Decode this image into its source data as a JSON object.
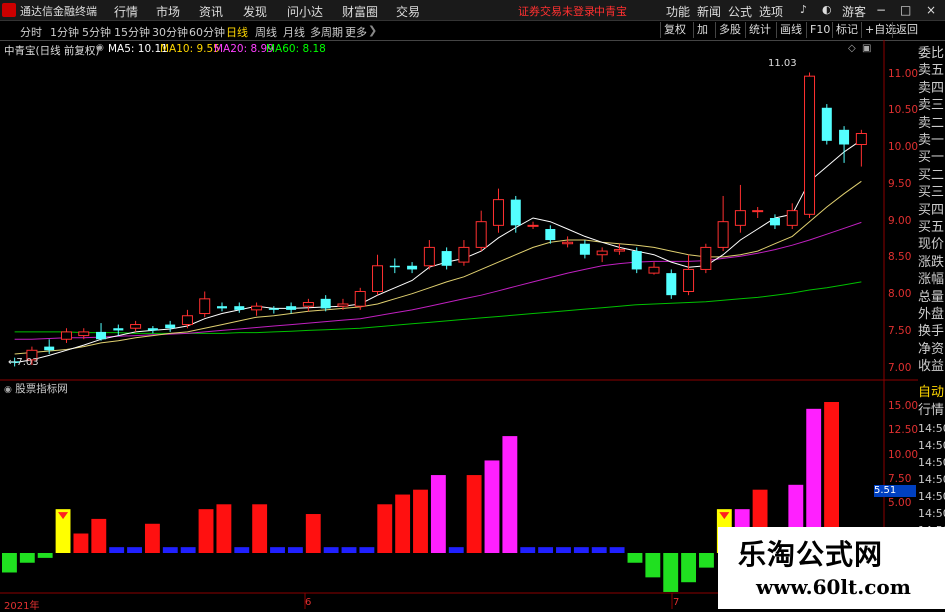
{
  "window": {
    "app_name": "通达信金融终端",
    "menus": [
      "行情",
      "市场",
      "资讯",
      "发现",
      "问小达",
      "财富圈",
      "交易"
    ],
    "warning": "证券交易未登录",
    "stock_name": "中青宝",
    "right_menus": [
      "功能",
      "新闻",
      "公式",
      "选项"
    ],
    "guest": "游客",
    "window_controls": [
      "−",
      "□",
      "×"
    ]
  },
  "toolbar": {
    "periods": [
      "分时",
      "1分钟",
      "5分钟",
      "15分钟",
      "30分钟",
      "60分钟",
      "日线",
      "周线",
      "月线",
      "多周期",
      "更多"
    ],
    "active_period": "日线",
    "buttons": [
      "复权",
      "加",
      "多股",
      "统计",
      "画线",
      "F10",
      "标记",
      "+自选",
      "返回"
    ]
  },
  "infobar": {
    "title": "中青宝(日线 前复权)",
    "ma5": "MA5: 10.11",
    "ma10": "MA10: 9.55",
    "ma20": "MA20: 8.99",
    "ma60": "MA60: 8.18",
    "colors": {
      "ma5": "#ffffff",
      "ma10": "#ffd700",
      "ma20": "#ff40ff",
      "ma60": "#00ff00"
    }
  },
  "side_panel": {
    "items": [
      "委比",
      "卖五",
      "卖四",
      "卖三",
      "卖二",
      "卖一",
      "买一",
      "买二",
      "买三",
      "买四",
      "买五",
      "现价",
      "涨跌",
      "涨幅",
      "总量",
      "外盘",
      "换手",
      "净资",
      "收益"
    ],
    "lower_items": [
      "自动",
      "行情"
    ]
  },
  "price_axis": {
    "ticks": [
      "11.00",
      "10.50",
      "10.00",
      "9.50",
      "9.00",
      "8.50",
      "8.00",
      "7.50",
      "7.00"
    ],
    "high_label": "11.03",
    "low_label": "7.03"
  },
  "indicator": {
    "title": "股票指标网",
    "ticks": [
      "15.00",
      "12.50",
      "10.00",
      "7.50",
      "5.00"
    ],
    "value_label": "5.51",
    "time_labels": [
      "14:50",
      "14:50",
      "14:50",
      "14:50",
      "14:50",
      "14:50",
      "14:50",
      "14:50",
      "14:50"
    ]
  },
  "date_axis": {
    "labels": [
      "2021年",
      "6",
      "7"
    ]
  },
  "chart_data": {
    "type": "candlestick",
    "price_range": [
      6.9,
      11.2
    ],
    "candles": [
      {
        "o": 7.1,
        "c": 7.08,
        "h": 7.15,
        "l": 7.03
      },
      {
        "o": 7.12,
        "c": 7.25,
        "h": 7.3,
        "l": 7.05
      },
      {
        "o": 7.3,
        "c": 7.25,
        "h": 7.4,
        "l": 7.2
      },
      {
        "o": 7.4,
        "c": 7.5,
        "h": 7.55,
        "l": 7.35
      },
      {
        "o": 7.45,
        "c": 7.5,
        "h": 7.55,
        "l": 7.4
      },
      {
        "o": 7.5,
        "c": 7.4,
        "h": 7.62,
        "l": 7.38
      },
      {
        "o": 7.55,
        "c": 7.52,
        "h": 7.6,
        "l": 7.45
      },
      {
        "o": 7.55,
        "c": 7.6,
        "h": 7.65,
        "l": 7.5
      },
      {
        "o": 7.55,
        "c": 7.52,
        "h": 7.58,
        "l": 7.48
      },
      {
        "o": 7.6,
        "c": 7.55,
        "h": 7.65,
        "l": 7.5
      },
      {
        "o": 7.6,
        "c": 7.72,
        "h": 7.8,
        "l": 7.55
      },
      {
        "o": 7.75,
        "c": 7.95,
        "h": 8.05,
        "l": 7.7
      },
      {
        "o": 7.85,
        "c": 7.82,
        "h": 7.9,
        "l": 7.78
      },
      {
        "o": 7.85,
        "c": 7.8,
        "h": 7.9,
        "l": 7.76
      },
      {
        "o": 7.8,
        "c": 7.85,
        "h": 7.9,
        "l": 7.72
      },
      {
        "o": 7.82,
        "c": 7.8,
        "h": 7.85,
        "l": 7.75
      },
      {
        "o": 7.85,
        "c": 7.8,
        "h": 7.9,
        "l": 7.75
      },
      {
        "o": 7.85,
        "c": 7.9,
        "h": 7.95,
        "l": 7.78
      },
      {
        "o": 7.95,
        "c": 7.82,
        "h": 8.0,
        "l": 7.78
      },
      {
        "o": 7.85,
        "c": 7.88,
        "h": 7.95,
        "l": 7.8
      },
      {
        "o": 7.85,
        "c": 8.05,
        "h": 8.1,
        "l": 7.8
      },
      {
        "o": 8.05,
        "c": 8.4,
        "h": 8.55,
        "l": 8.0
      },
      {
        "o": 8.4,
        "c": 8.38,
        "h": 8.5,
        "l": 8.3
      },
      {
        "o": 8.4,
        "c": 8.35,
        "h": 8.45,
        "l": 8.3
      },
      {
        "o": 8.4,
        "c": 8.65,
        "h": 8.75,
        "l": 8.35
      },
      {
        "o": 8.6,
        "c": 8.4,
        "h": 8.65,
        "l": 8.35
      },
      {
        "o": 8.45,
        "c": 8.65,
        "h": 8.75,
        "l": 8.4
      },
      {
        "o": 8.65,
        "c": 9.0,
        "h": 9.15,
        "l": 8.6
      },
      {
        "o": 8.95,
        "c": 9.3,
        "h": 9.45,
        "l": 8.85
      },
      {
        "o": 9.3,
        "c": 8.95,
        "h": 9.35,
        "l": 8.85
      },
      {
        "o": 8.95,
        "c": 8.95,
        "h": 9.0,
        "l": 8.9
      },
      {
        "o": 8.9,
        "c": 8.75,
        "h": 8.95,
        "l": 8.7
      },
      {
        "o": 8.7,
        "c": 8.72,
        "h": 8.8,
        "l": 8.65
      },
      {
        "o": 8.7,
        "c": 8.55,
        "h": 8.75,
        "l": 8.5
      },
      {
        "o": 8.55,
        "c": 8.6,
        "h": 8.65,
        "l": 8.45
      },
      {
        "o": 8.6,
        "c": 8.62,
        "h": 8.7,
        "l": 8.55
      },
      {
        "o": 8.6,
        "c": 8.35,
        "h": 8.65,
        "l": 8.3
      },
      {
        "o": 8.3,
        "c": 8.38,
        "h": 8.45,
        "l": 8.28
      },
      {
        "o": 8.3,
        "c": 8.0,
        "h": 8.35,
        "l": 7.95
      },
      {
        "o": 8.05,
        "c": 8.35,
        "h": 8.55,
        "l": 8.0
      },
      {
        "o": 8.35,
        "c": 8.65,
        "h": 8.7,
        "l": 8.3
      },
      {
        "o": 8.65,
        "c": 9.0,
        "h": 9.35,
        "l": 8.6
      },
      {
        "o": 8.95,
        "c": 9.15,
        "h": 9.5,
        "l": 8.85
      },
      {
        "o": 9.15,
        "c": 9.15,
        "h": 9.2,
        "l": 9.05
      },
      {
        "o": 9.05,
        "c": 8.95,
        "h": 9.1,
        "l": 8.9
      },
      {
        "o": 8.95,
        "c": 9.15,
        "h": 9.25,
        "l": 8.9
      },
      {
        "o": 9.1,
        "c": 10.98,
        "h": 11.03,
        "l": 9.05
      },
      {
        "o": 10.55,
        "c": 10.1,
        "h": 10.6,
        "l": 10.05
      },
      {
        "o": 10.25,
        "c": 10.05,
        "h": 10.3,
        "l": 9.8
      },
      {
        "o": 10.05,
        "c": 10.2,
        "h": 10.25,
        "l": 9.75
      }
    ],
    "ma5": [
      7.08,
      7.12,
      7.18,
      7.25,
      7.32,
      7.4,
      7.45,
      7.5,
      7.52,
      7.54,
      7.58,
      7.68,
      7.75,
      7.8,
      7.85,
      7.82,
      7.82,
      7.83,
      7.84,
      7.85,
      7.88,
      8.0,
      8.1,
      8.2,
      8.38,
      8.45,
      8.5,
      8.6,
      8.78,
      8.92,
      9.05,
      9.0,
      8.9,
      8.8,
      8.72,
      8.65,
      8.6,
      8.55,
      8.45,
      8.38,
      8.4,
      8.55,
      8.75,
      8.9,
      9.05,
      9.1,
      9.55,
      9.75,
      9.95,
      10.11
    ],
    "ma10": [
      7.2,
      7.22,
      7.24,
      7.26,
      7.3,
      7.35,
      7.38,
      7.42,
      7.45,
      7.48,
      7.5,
      7.55,
      7.6,
      7.65,
      7.7,
      7.72,
      7.75,
      7.78,
      7.8,
      7.82,
      7.84,
      7.88,
      7.95,
      8.02,
      8.1,
      8.18,
      8.25,
      8.35,
      8.45,
      8.55,
      8.65,
      8.72,
      8.75,
      8.75,
      8.72,
      8.7,
      8.68,
      8.65,
      8.6,
      8.55,
      8.52,
      8.52,
      8.55,
      8.6,
      8.7,
      8.8,
      9.0,
      9.2,
      9.38,
      9.55
    ],
    "ma20": [
      7.4,
      7.4,
      7.41,
      7.42,
      7.42,
      7.43,
      7.44,
      7.45,
      7.46,
      7.47,
      7.48,
      7.5,
      7.52,
      7.54,
      7.56,
      7.58,
      7.6,
      7.62,
      7.64,
      7.66,
      7.68,
      7.72,
      7.76,
      7.8,
      7.85,
      7.9,
      7.95,
      8.0,
      8.06,
      8.12,
      8.18,
      8.24,
      8.3,
      8.35,
      8.4,
      8.43,
      8.45,
      8.46,
      8.46,
      8.46,
      8.47,
      8.5,
      8.53,
      8.57,
      8.62,
      8.68,
      8.75,
      8.83,
      8.91,
      8.99
    ],
    "ma60": [
      7.5,
      7.5,
      7.5,
      7.5,
      7.49,
      7.49,
      7.49,
      7.48,
      7.48,
      7.48,
      7.48,
      7.48,
      7.48,
      7.49,
      7.49,
      7.5,
      7.51,
      7.52,
      7.53,
      7.54,
      7.55,
      7.57,
      7.59,
      7.61,
      7.63,
      7.65,
      7.67,
      7.69,
      7.71,
      7.73,
      7.75,
      7.77,
      7.79,
      7.81,
      7.83,
      7.85,
      7.87,
      7.88,
      7.89,
      7.9,
      7.91,
      7.93,
      7.95,
      7.97,
      8.0,
      8.03,
      8.07,
      8.1,
      8.14,
      8.18
    ],
    "indicator_range": [
      -2,
      16
    ],
    "indicator_bars": [
      {
        "v": -2,
        "c": "green"
      },
      {
        "v": -1,
        "c": "green"
      },
      {
        "v": -0.5,
        "c": "green"
      },
      {
        "v": 4.5,
        "c": "yellow"
      },
      {
        "v": 2,
        "c": "red"
      },
      {
        "v": 3.5,
        "c": "red"
      },
      {
        "v": 0.6,
        "c": "blue"
      },
      {
        "v": 0.6,
        "c": "blue"
      },
      {
        "v": 3,
        "c": "red"
      },
      {
        "v": 0.6,
        "c": "blue"
      },
      {
        "v": 0.6,
        "c": "blue"
      },
      {
        "v": 4.5,
        "c": "red"
      },
      {
        "v": 5,
        "c": "red"
      },
      {
        "v": 0.6,
        "c": "blue"
      },
      {
        "v": 5,
        "c": "red"
      },
      {
        "v": 0.6,
        "c": "blue"
      },
      {
        "v": 0.6,
        "c": "blue"
      },
      {
        "v": 4,
        "c": "red"
      },
      {
        "v": 0.6,
        "c": "blue"
      },
      {
        "v": 0.6,
        "c": "blue"
      },
      {
        "v": 0.6,
        "c": "blue"
      },
      {
        "v": 5,
        "c": "red"
      },
      {
        "v": 6,
        "c": "red"
      },
      {
        "v": 6.5,
        "c": "red"
      },
      {
        "v": 8,
        "c": "magenta"
      },
      {
        "v": 0.6,
        "c": "blue"
      },
      {
        "v": 8,
        "c": "red"
      },
      {
        "v": 9.5,
        "c": "magenta"
      },
      {
        "v": 12,
        "c": "magenta"
      },
      {
        "v": 0.6,
        "c": "blue"
      },
      {
        "v": 0.6,
        "c": "blue"
      },
      {
        "v": 0.6,
        "c": "blue"
      },
      {
        "v": 0.6,
        "c": "blue"
      },
      {
        "v": 0.6,
        "c": "blue"
      },
      {
        "v": 0.6,
        "c": "blue"
      },
      {
        "v": -1,
        "c": "green"
      },
      {
        "v": -2.5,
        "c": "green"
      },
      {
        "v": -4,
        "c": "green"
      },
      {
        "v": -3,
        "c": "green"
      },
      {
        "v": -1.5,
        "c": "green"
      },
      {
        "v": 4.5,
        "c": "yellow"
      },
      {
        "v": 4.5,
        "c": "magenta"
      },
      {
        "v": 6.5,
        "c": "red"
      },
      {
        "v": 0,
        "c": "none"
      },
      {
        "v": 7,
        "c": "magenta"
      },
      {
        "v": 14.8,
        "c": "magenta"
      },
      {
        "v": 15.5,
        "c": "red"
      }
    ],
    "signals": [
      3,
      40
    ]
  },
  "watermark": {
    "title": "乐淘公式网",
    "url": "www.60lt.com"
  }
}
